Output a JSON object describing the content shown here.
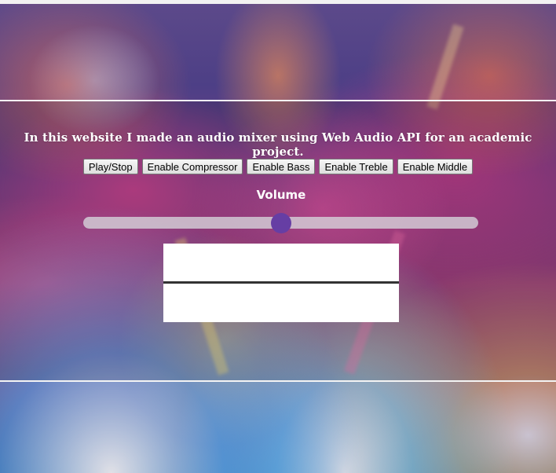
{
  "page": {
    "headline": "In this website I made an audio mixer using Web Audio API for an academic project.",
    "volume_label": "Volume"
  },
  "controls": {
    "play_stop": "Play/Stop",
    "compressor": "Enable Compressor",
    "bass": "Enable Bass",
    "treble": "Enable Treble",
    "middle": "Enable Middle"
  },
  "volume": {
    "value": 0.5
  },
  "colors": {
    "slider_thumb": "#663ea4",
    "slider_track": "#d7d7dc",
    "rule": "#f4f4f4"
  }
}
